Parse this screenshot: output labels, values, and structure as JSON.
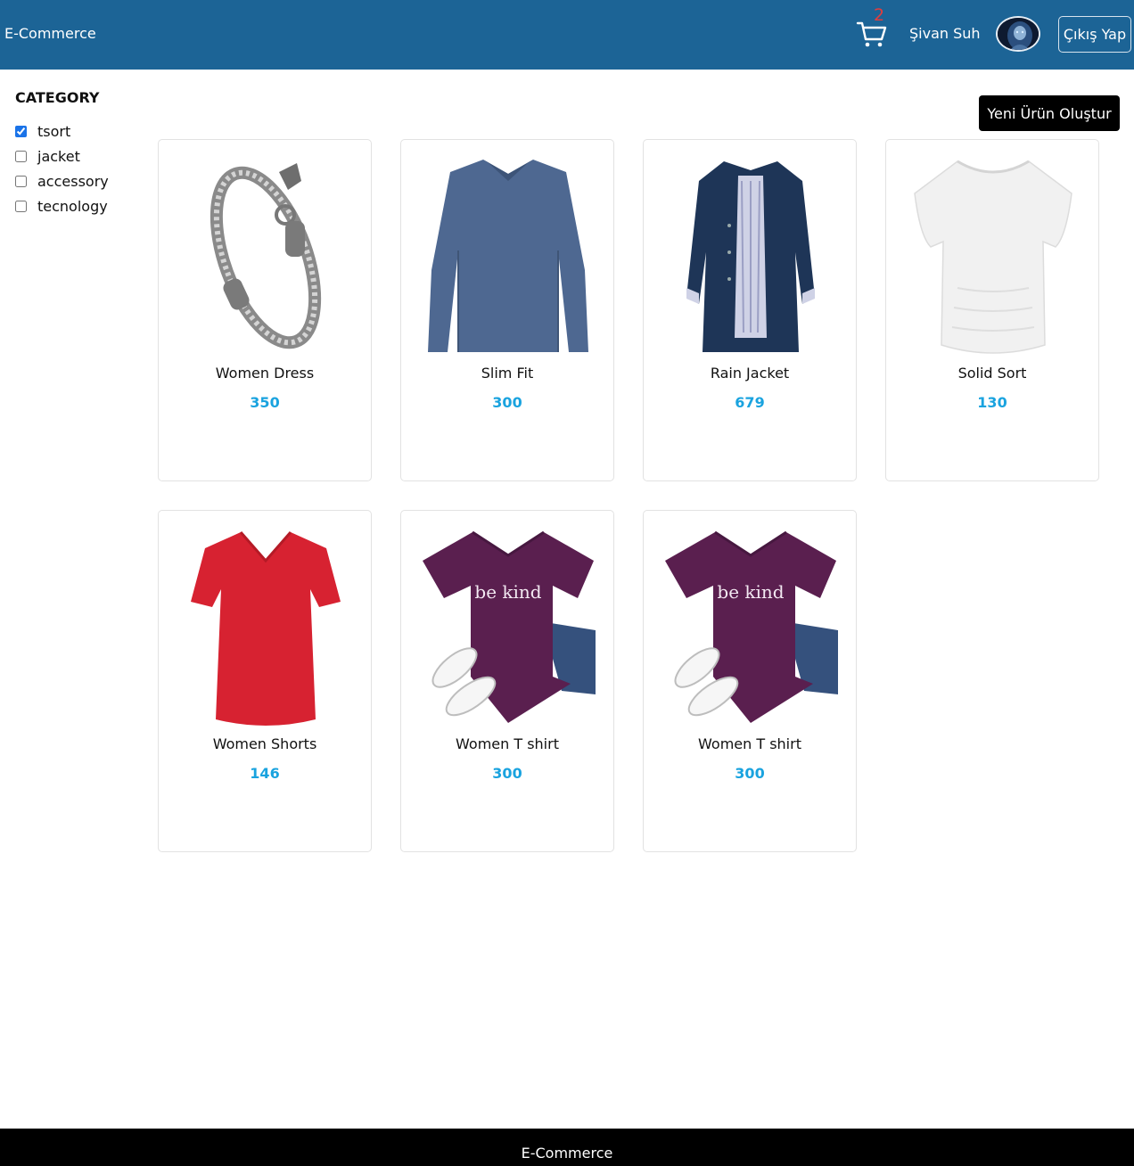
{
  "header": {
    "brand": "E-Commerce",
    "cart_count": "2",
    "cart_icon": "cart-icon",
    "username": "Şivan Suh",
    "avatar_icon": "avatar-icon",
    "logout_label": "Çıkış Yap",
    "colors": {
      "background": "#1c6496",
      "cart_badge": "#e23d3d"
    }
  },
  "sidebar": {
    "title": "CATEGORY",
    "categories": [
      {
        "label": "tsort",
        "checked": true
      },
      {
        "label": "jacket",
        "checked": false
      },
      {
        "label": "accessory",
        "checked": false
      },
      {
        "label": "tecnology",
        "checked": false
      }
    ]
  },
  "main": {
    "create_button_label": "Yeni Ürün Oluştur",
    "price_color": "#1aa3df",
    "products": [
      {
        "name": "Women Dress",
        "price": "350",
        "image_icon": "bracelet-image"
      },
      {
        "name": "Slim Fit",
        "price": "300",
        "image_icon": "long-sleeve-shirt-image"
      },
      {
        "name": "Rain Jacket",
        "price": "679",
        "image_icon": "rain-jacket-image"
      },
      {
        "name": "Solid Sort",
        "price": "130",
        "image_icon": "white-top-image"
      },
      {
        "name": "Women Shorts",
        "price": "146",
        "image_icon": "red-tshirt-image"
      },
      {
        "name": "Women T shirt",
        "price": "300",
        "image_icon": "purple-tshirt-outfit-image",
        "print": "be kind"
      },
      {
        "name": "Women T shirt",
        "price": "300",
        "image_icon": "purple-tshirt-outfit-image",
        "print": "be kind"
      }
    ]
  },
  "footer": {
    "text": "E-Commerce"
  }
}
